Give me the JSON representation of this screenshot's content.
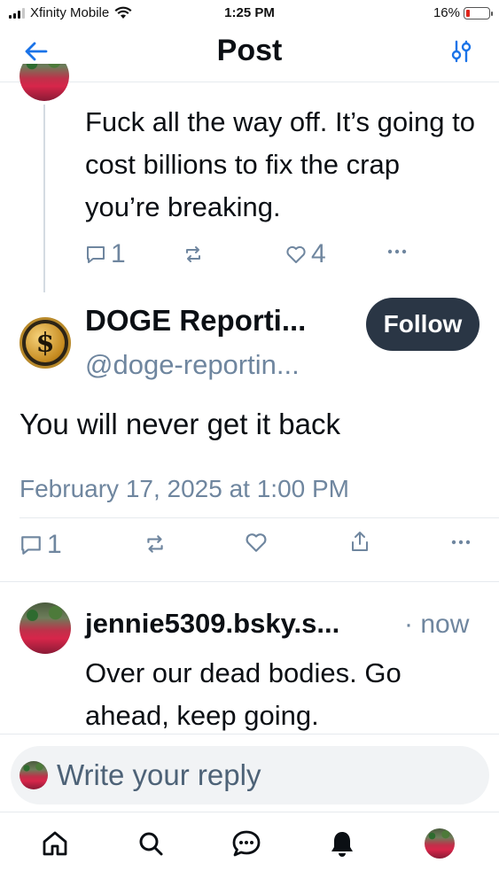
{
  "status_bar": {
    "carrier": "Xfinity Mobile",
    "time": "1:25 PM",
    "battery": "16%",
    "battery_level": 0.16
  },
  "header": {
    "title": "Post"
  },
  "parent_post": {
    "text": "Fuck all the way off. It’s going to cost billions to fix the crap you’re breaking.",
    "reply_count": "1",
    "like_count": "4"
  },
  "main_post": {
    "display_name": "DOGE Reporti...",
    "handle": "@doge-reportin...",
    "follow_label": "Follow",
    "text": "You will never get it back",
    "date": "February 17, 2025 at 1:00 PM",
    "reply_count": "1",
    "avatar_symbol": "$"
  },
  "reply_post": {
    "display_name": "jennie5309.bsky.s...",
    "time": "· now",
    "text": "Over our dead bodies. Go ahead, keep going."
  },
  "composer": {
    "placeholder": "Write your reply"
  },
  "colors": {
    "muted": "#6f869f",
    "follow_bg": "#2a3645",
    "battery_low": "#e0241b"
  }
}
